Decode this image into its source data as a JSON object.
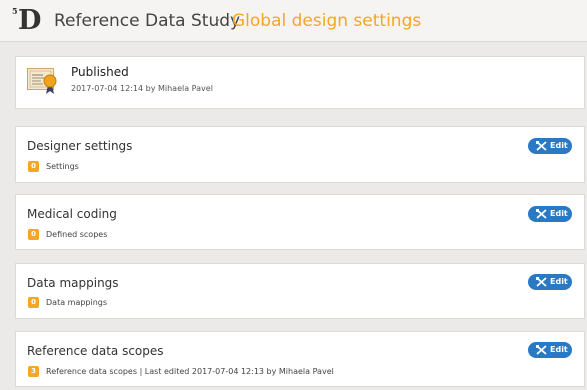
{
  "header": {
    "logo": "D",
    "logo_sup": "5",
    "study": "Reference Data Study",
    "separator": "›",
    "page": "Global design settings"
  },
  "published": {
    "title": "Published",
    "meta": "2017-07-04 12:14 by Mihaela Pavel"
  },
  "edit_label": "Edit",
  "sections": [
    {
      "title": "Designer settings",
      "count": "0",
      "text": "Settings"
    },
    {
      "title": "Medical coding",
      "count": "0",
      "text": "Defined scopes"
    },
    {
      "title": "Data mappings",
      "count": "0",
      "text": "Data mappings"
    },
    {
      "title": "Reference data scopes",
      "count": "3",
      "text": "Reference data scopes | Last edited 2017-07-04 12:13 by Mihaela Pavel"
    }
  ],
  "colors": {
    "accent": "#f5a623",
    "button": "#2a79c4"
  }
}
